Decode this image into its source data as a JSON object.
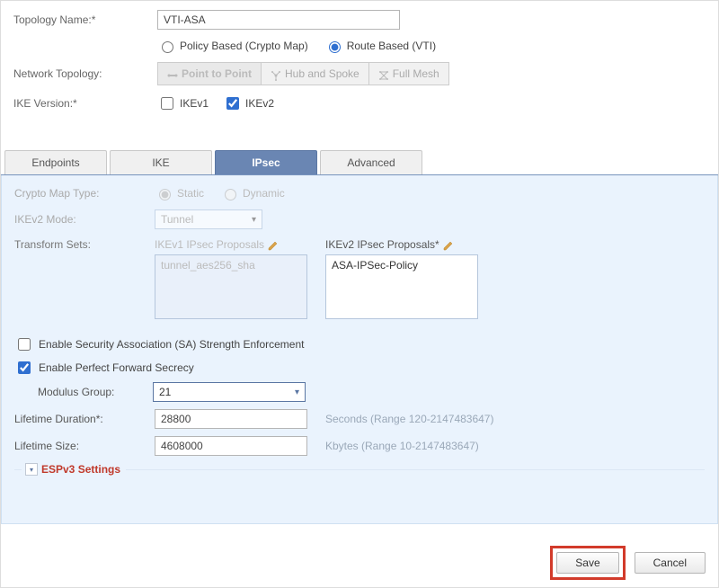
{
  "header": {
    "topology_name_label": "Topology Name:*",
    "topology_name_value": "VTI-ASA",
    "policy_based_label": "Policy Based (Crypto Map)",
    "route_based_label": "Route Based (VTI)",
    "policy_type_selected": "route",
    "network_topology_label": "Network Topology:",
    "topo_buttons": {
      "p2p": "Point to Point",
      "hub": "Hub and Spoke",
      "mesh": "Full Mesh",
      "active": "p2p"
    },
    "ike_version_label": "IKE Version:*",
    "ikev1_label": "IKEv1",
    "ikev1_checked": false,
    "ikev2_label": "IKEv2",
    "ikev2_checked": true
  },
  "tabs": {
    "endpoints": "Endpoints",
    "ike": "IKE",
    "ipsec": "IPsec",
    "advanced": "Advanced",
    "active": "ipsec"
  },
  "ipsec": {
    "crypto_map_type_label": "Crypto Map Type:",
    "crypto_static": "Static",
    "crypto_dynamic": "Dynamic",
    "crypto_selected": "static",
    "ikev2_mode_label": "IKEv2 Mode:",
    "ikev2_mode_value": "Tunnel",
    "transform_sets_label": "Transform Sets:",
    "ikev1_proposals_label": "IKEv1 IPsec Proposals",
    "ikev1_proposals_value": "tunnel_aes256_sha",
    "ikev2_proposals_label": "IKEv2 IPsec Proposals*",
    "ikev2_proposals_value": "ASA-IPSec-Policy",
    "enable_sa_label": "Enable Security Association (SA) Strength Enforcement",
    "enable_sa_checked": false,
    "enable_pfs_label": "Enable Perfect Forward Secrecy",
    "enable_pfs_checked": true,
    "modulus_group_label": "Modulus Group:",
    "modulus_group_value": "21",
    "lifetime_duration_label": "Lifetime Duration*:",
    "lifetime_duration_value": "28800",
    "lifetime_duration_hint": "Seconds (Range 120-2147483647)",
    "lifetime_size_label": "Lifetime Size:",
    "lifetime_size_value": "4608000",
    "lifetime_size_hint": "Kbytes (Range 10-2147483647)",
    "espv3_label": "ESPv3 Settings"
  },
  "footer": {
    "save": "Save",
    "cancel": "Cancel"
  }
}
